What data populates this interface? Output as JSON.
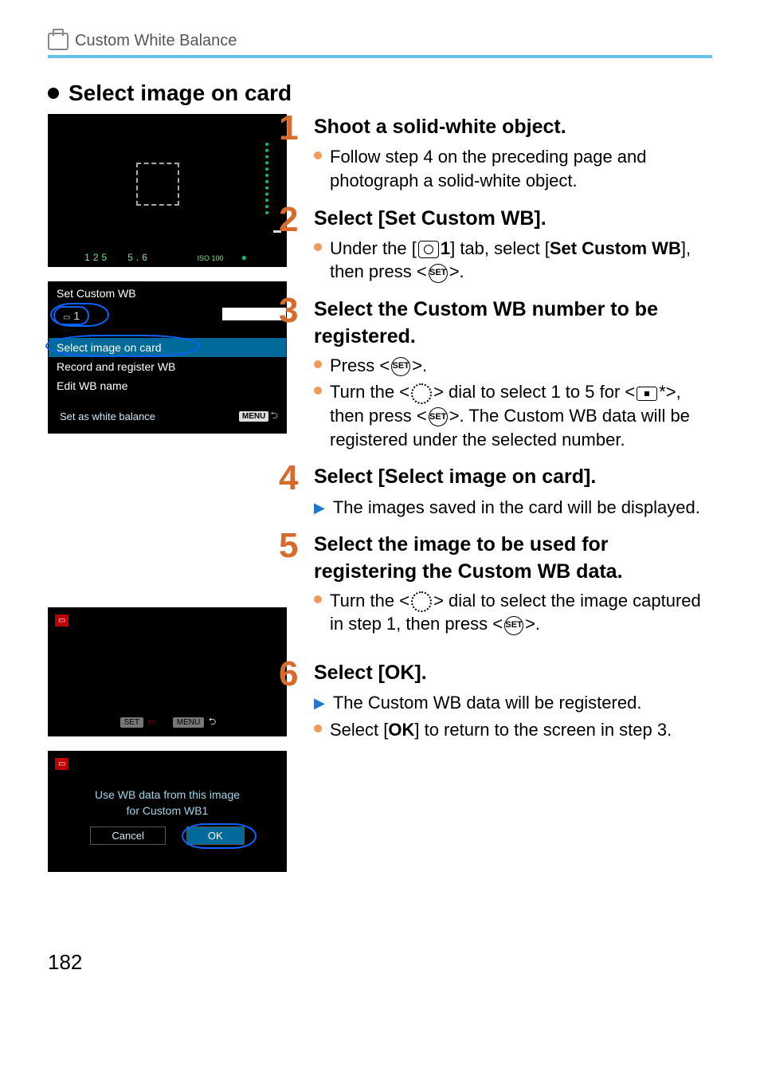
{
  "header": {
    "breadcrumb": "Custom White Balance"
  },
  "section_title": "Select image on card",
  "sim1": {
    "bottom_left": "125",
    "bottom_mid": "5.6",
    "bottom_right_iso": "ISO 100"
  },
  "sim2": {
    "title": "Set Custom WB",
    "slot": "1",
    "row_sel": "Select image on card",
    "row_rec": "Record and register WB",
    "row_edit": "Edit WB name",
    "row_setas": "Set as white balance",
    "menu": "MENU"
  },
  "sim5": {
    "set": "SET",
    "menu": "MENU"
  },
  "sim6": {
    "line1": "Use WB data from this image",
    "line2": "for Custom WB1",
    "cancel": "Cancel",
    "ok": "OK"
  },
  "steps": {
    "s1": {
      "num": "1",
      "title": "Shoot a solid-white object.",
      "b1": "Follow step 4 on the preceding page and photograph a solid-white object."
    },
    "s2": {
      "num": "2",
      "title": "Select [Set Custom WB].",
      "b1_pre": "Under the [",
      "b1_mid": "1",
      "b1_post": "] tab, select [",
      "b1_bold": "Set Custom WB",
      "b1_end": "], then press <",
      "b1_icon": "SET",
      "b1_final": ">."
    },
    "s3": {
      "num": "3",
      "title": "Select the Custom WB number to be registered.",
      "b1_pre": "Press <",
      "b1_icon": "SET",
      "b1_post": ">.",
      "b2": "Turn the <    > dial to select 1 to 5 for <     *>, then press <    >. The Custom WB data will be registered under the selected number.",
      "b2_pre": "Turn the <",
      "b2_mid": "> dial to select 1 to 5 for <",
      "b2_mid2": "*>, then press <",
      "b2_icon": "SET",
      "b2_post": ">. The Custom WB data will be registered under the selected number."
    },
    "s4": {
      "num": "4",
      "title": "Select [Select image on card].",
      "b1": "The images saved in the card will be displayed."
    },
    "s5": {
      "num": "5",
      "title": "Select the image to be used for registering the Custom WB data.",
      "b1_pre": "Turn the <",
      "b1_mid": "> dial to select the image captured in step 1, then press <",
      "b1_icon": "SET",
      "b1_post": ">."
    },
    "s6": {
      "num": "6",
      "title": "Select [OK].",
      "b1": "The Custom WB data will be registered.",
      "b2_pre": "Select [",
      "b2_bold": "OK",
      "b2_post": "] to return to the screen in step 3."
    }
  },
  "page_number": "182"
}
